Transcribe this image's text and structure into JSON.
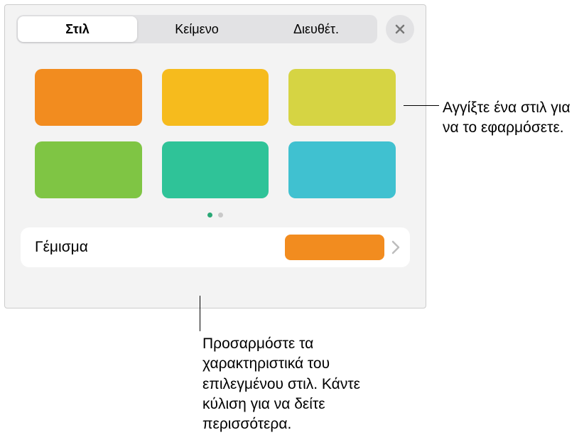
{
  "tabs": {
    "style": "Στιλ",
    "text": "Κείμενο",
    "arrange": "Διευθέτ."
  },
  "swatches": [
    "#f28c1f",
    "#f6bb1d",
    "#d6d443",
    "#7fc544",
    "#2fc398",
    "#40c1d0"
  ],
  "fill": {
    "label": "Γέμισμα",
    "color": "#f28c1f"
  },
  "pageDots": {
    "count": 2,
    "activeIndex": 0
  },
  "callouts": {
    "tapStyle": "Αγγίξτε ένα στιλ για να το εφαρμόσετε.",
    "customize": "Προσαρμόστε τα χαρακτηριστικά του επιλεγμένου στιλ. Κάντε κύλιση για να δείτε περισσότερα."
  }
}
